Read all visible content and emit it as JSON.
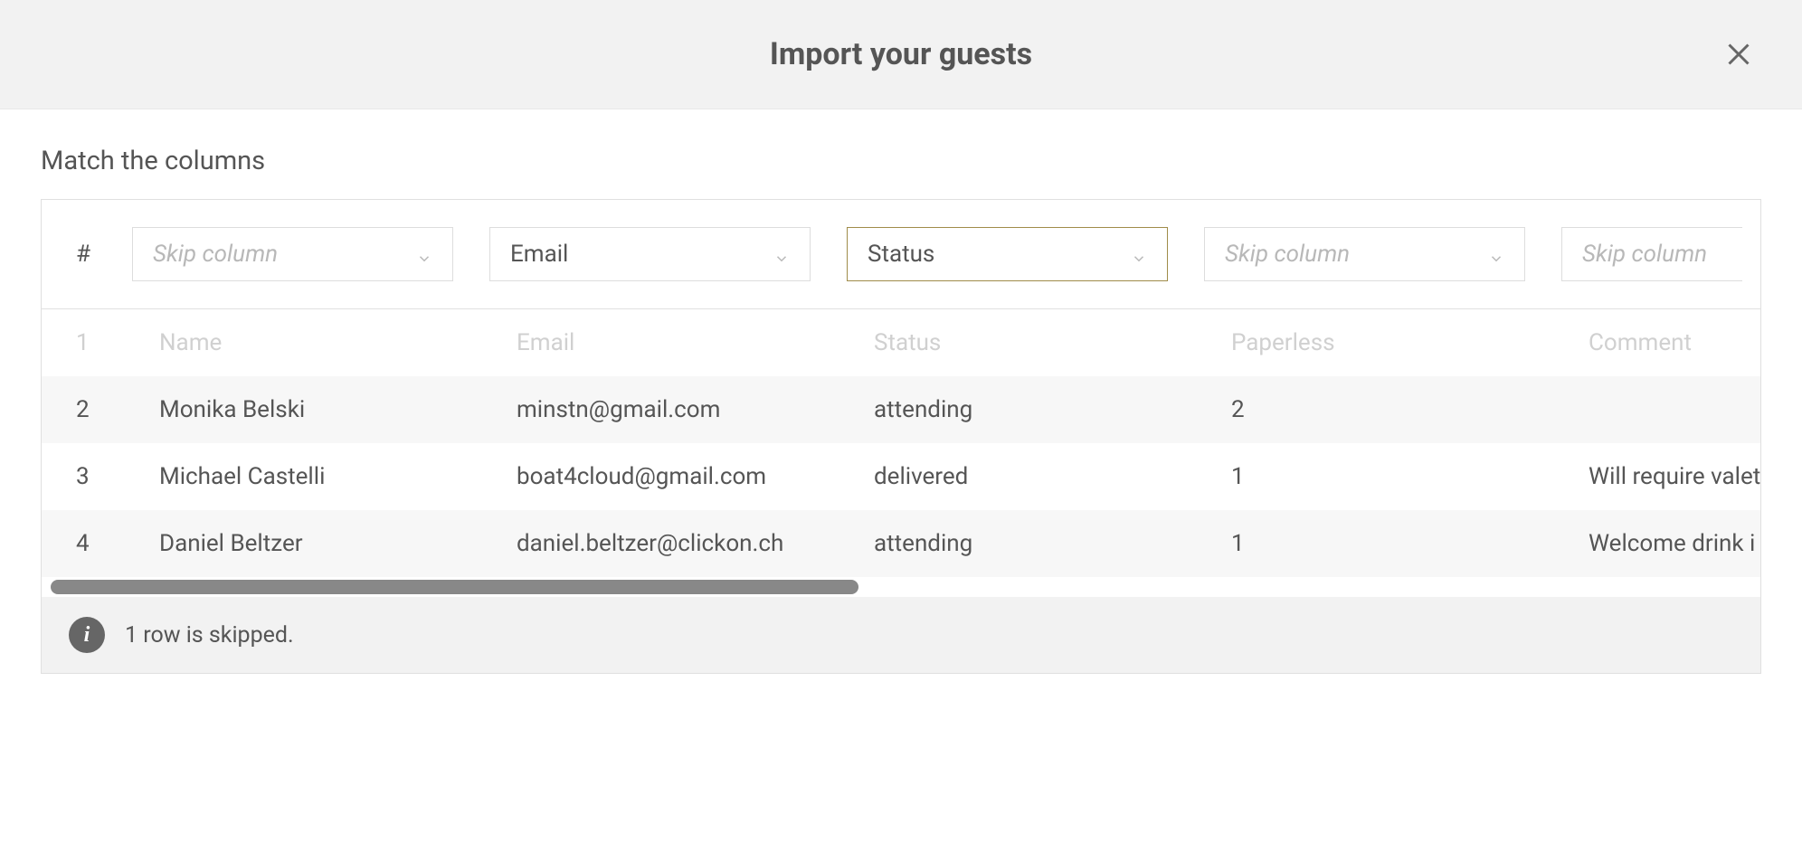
{
  "header": {
    "title": "Import your guests"
  },
  "section": {
    "title": "Match the columns"
  },
  "selectors": {
    "index_label": "#",
    "columns": [
      {
        "label": "Skip column",
        "placeholder": true,
        "active": false
      },
      {
        "label": "Email",
        "placeholder": false,
        "active": false
      },
      {
        "label": "Status",
        "placeholder": false,
        "active": true
      },
      {
        "label": "Skip column",
        "placeholder": true,
        "active": false
      },
      {
        "label": "Skip column",
        "placeholder": true,
        "active": false,
        "partial": true
      }
    ]
  },
  "table": {
    "header_row": {
      "index": "1",
      "cells": [
        "Name",
        "Email",
        "Status",
        "Paperless",
        "Comment"
      ]
    },
    "rows": [
      {
        "index": "2",
        "cells": [
          "Monika Belski",
          "minstn@gmail.com",
          "attending",
          "2",
          ""
        ]
      },
      {
        "index": "3",
        "cells": [
          "Michael Castelli",
          "boat4cloud@gmail.com",
          "delivered",
          "1",
          "Will require valet"
        ]
      },
      {
        "index": "4",
        "cells": [
          "Daniel Beltzer",
          "daniel.beltzer@clickon.ch",
          "attending",
          "1",
          "Welcome drink i"
        ]
      }
    ]
  },
  "info": {
    "message": "1 row is skipped."
  }
}
